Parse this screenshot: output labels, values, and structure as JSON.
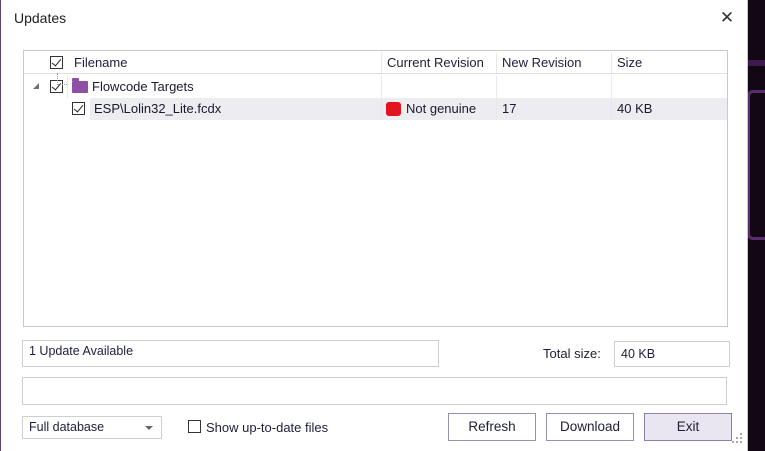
{
  "window": {
    "title": "Updates",
    "close_glyph": "✕"
  },
  "grid": {
    "columns": [
      "Filename",
      "Current Revision",
      "New Revision",
      "Size"
    ],
    "group": {
      "label": "Flowcode Targets",
      "icon": "folder-icon"
    },
    "rows": [
      {
        "filename": "ESP\\Lolin32_Lite.fcdx",
        "current_revision": "Not genuine",
        "new_revision": "17",
        "size": "40 KB",
        "status_color": "#e4141e"
      }
    ]
  },
  "summary": {
    "updates_available": "1 Update Available",
    "total_size_label": "Total size:",
    "total_size_value": "40 KB"
  },
  "progress": {
    "text": ""
  },
  "footer": {
    "database_select": "Full database",
    "show_uptodate_label": "Show up-to-date files",
    "refresh_label": "Refresh",
    "download_label": "Download",
    "exit_label": "Exit"
  },
  "colors": {
    "accent": "#8e4fa6",
    "button_border": "#9b8fb5",
    "status_red": "#e4141e"
  }
}
